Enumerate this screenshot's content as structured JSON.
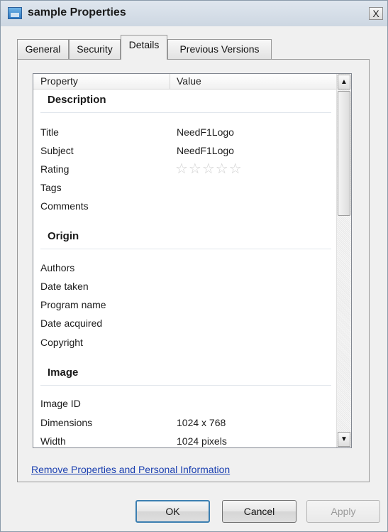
{
  "window": {
    "title": "sample Properties",
    "close_glyph": "X"
  },
  "tabs": [
    {
      "label": "General",
      "active": false
    },
    {
      "label": "Security",
      "active": false
    },
    {
      "label": "Details",
      "active": true
    },
    {
      "label": "Previous Versions",
      "active": false
    }
  ],
  "list": {
    "headers": {
      "property": "Property",
      "value": "Value"
    },
    "groups": {
      "description": {
        "title": "Description",
        "rows": [
          {
            "property": "Title",
            "value": "NeedF1Logo"
          },
          {
            "property": "Subject",
            "value": "NeedF1Logo"
          },
          {
            "property": "Rating",
            "value": ""
          },
          {
            "property": "Tags",
            "value": ""
          },
          {
            "property": "Comments",
            "value": ""
          }
        ]
      },
      "origin": {
        "title": "Origin",
        "rows": [
          {
            "property": "Authors",
            "value": ""
          },
          {
            "property": "Date taken",
            "value": ""
          },
          {
            "property": "Program name",
            "value": ""
          },
          {
            "property": "Date acquired",
            "value": ""
          },
          {
            "property": "Copyright",
            "value": ""
          }
        ]
      },
      "image": {
        "title": "Image",
        "rows": [
          {
            "property": "Image ID",
            "value": ""
          },
          {
            "property": "Dimensions",
            "value": "1024 x 768"
          },
          {
            "property": "Width",
            "value": "1024 pixels"
          }
        ]
      }
    },
    "rating": {
      "stars_glyph": "☆☆☆☆☆",
      "value": 0,
      "max": 5
    }
  },
  "links": {
    "remove_properties": "Remove Properties and Personal Information"
  },
  "buttons": {
    "ok": "OK",
    "cancel": "Cancel",
    "apply": "Apply"
  },
  "colors": {
    "link": "#1a3fb0",
    "ok_border": "#3c7fb1",
    "disabled_text": "#9a9a9a"
  }
}
